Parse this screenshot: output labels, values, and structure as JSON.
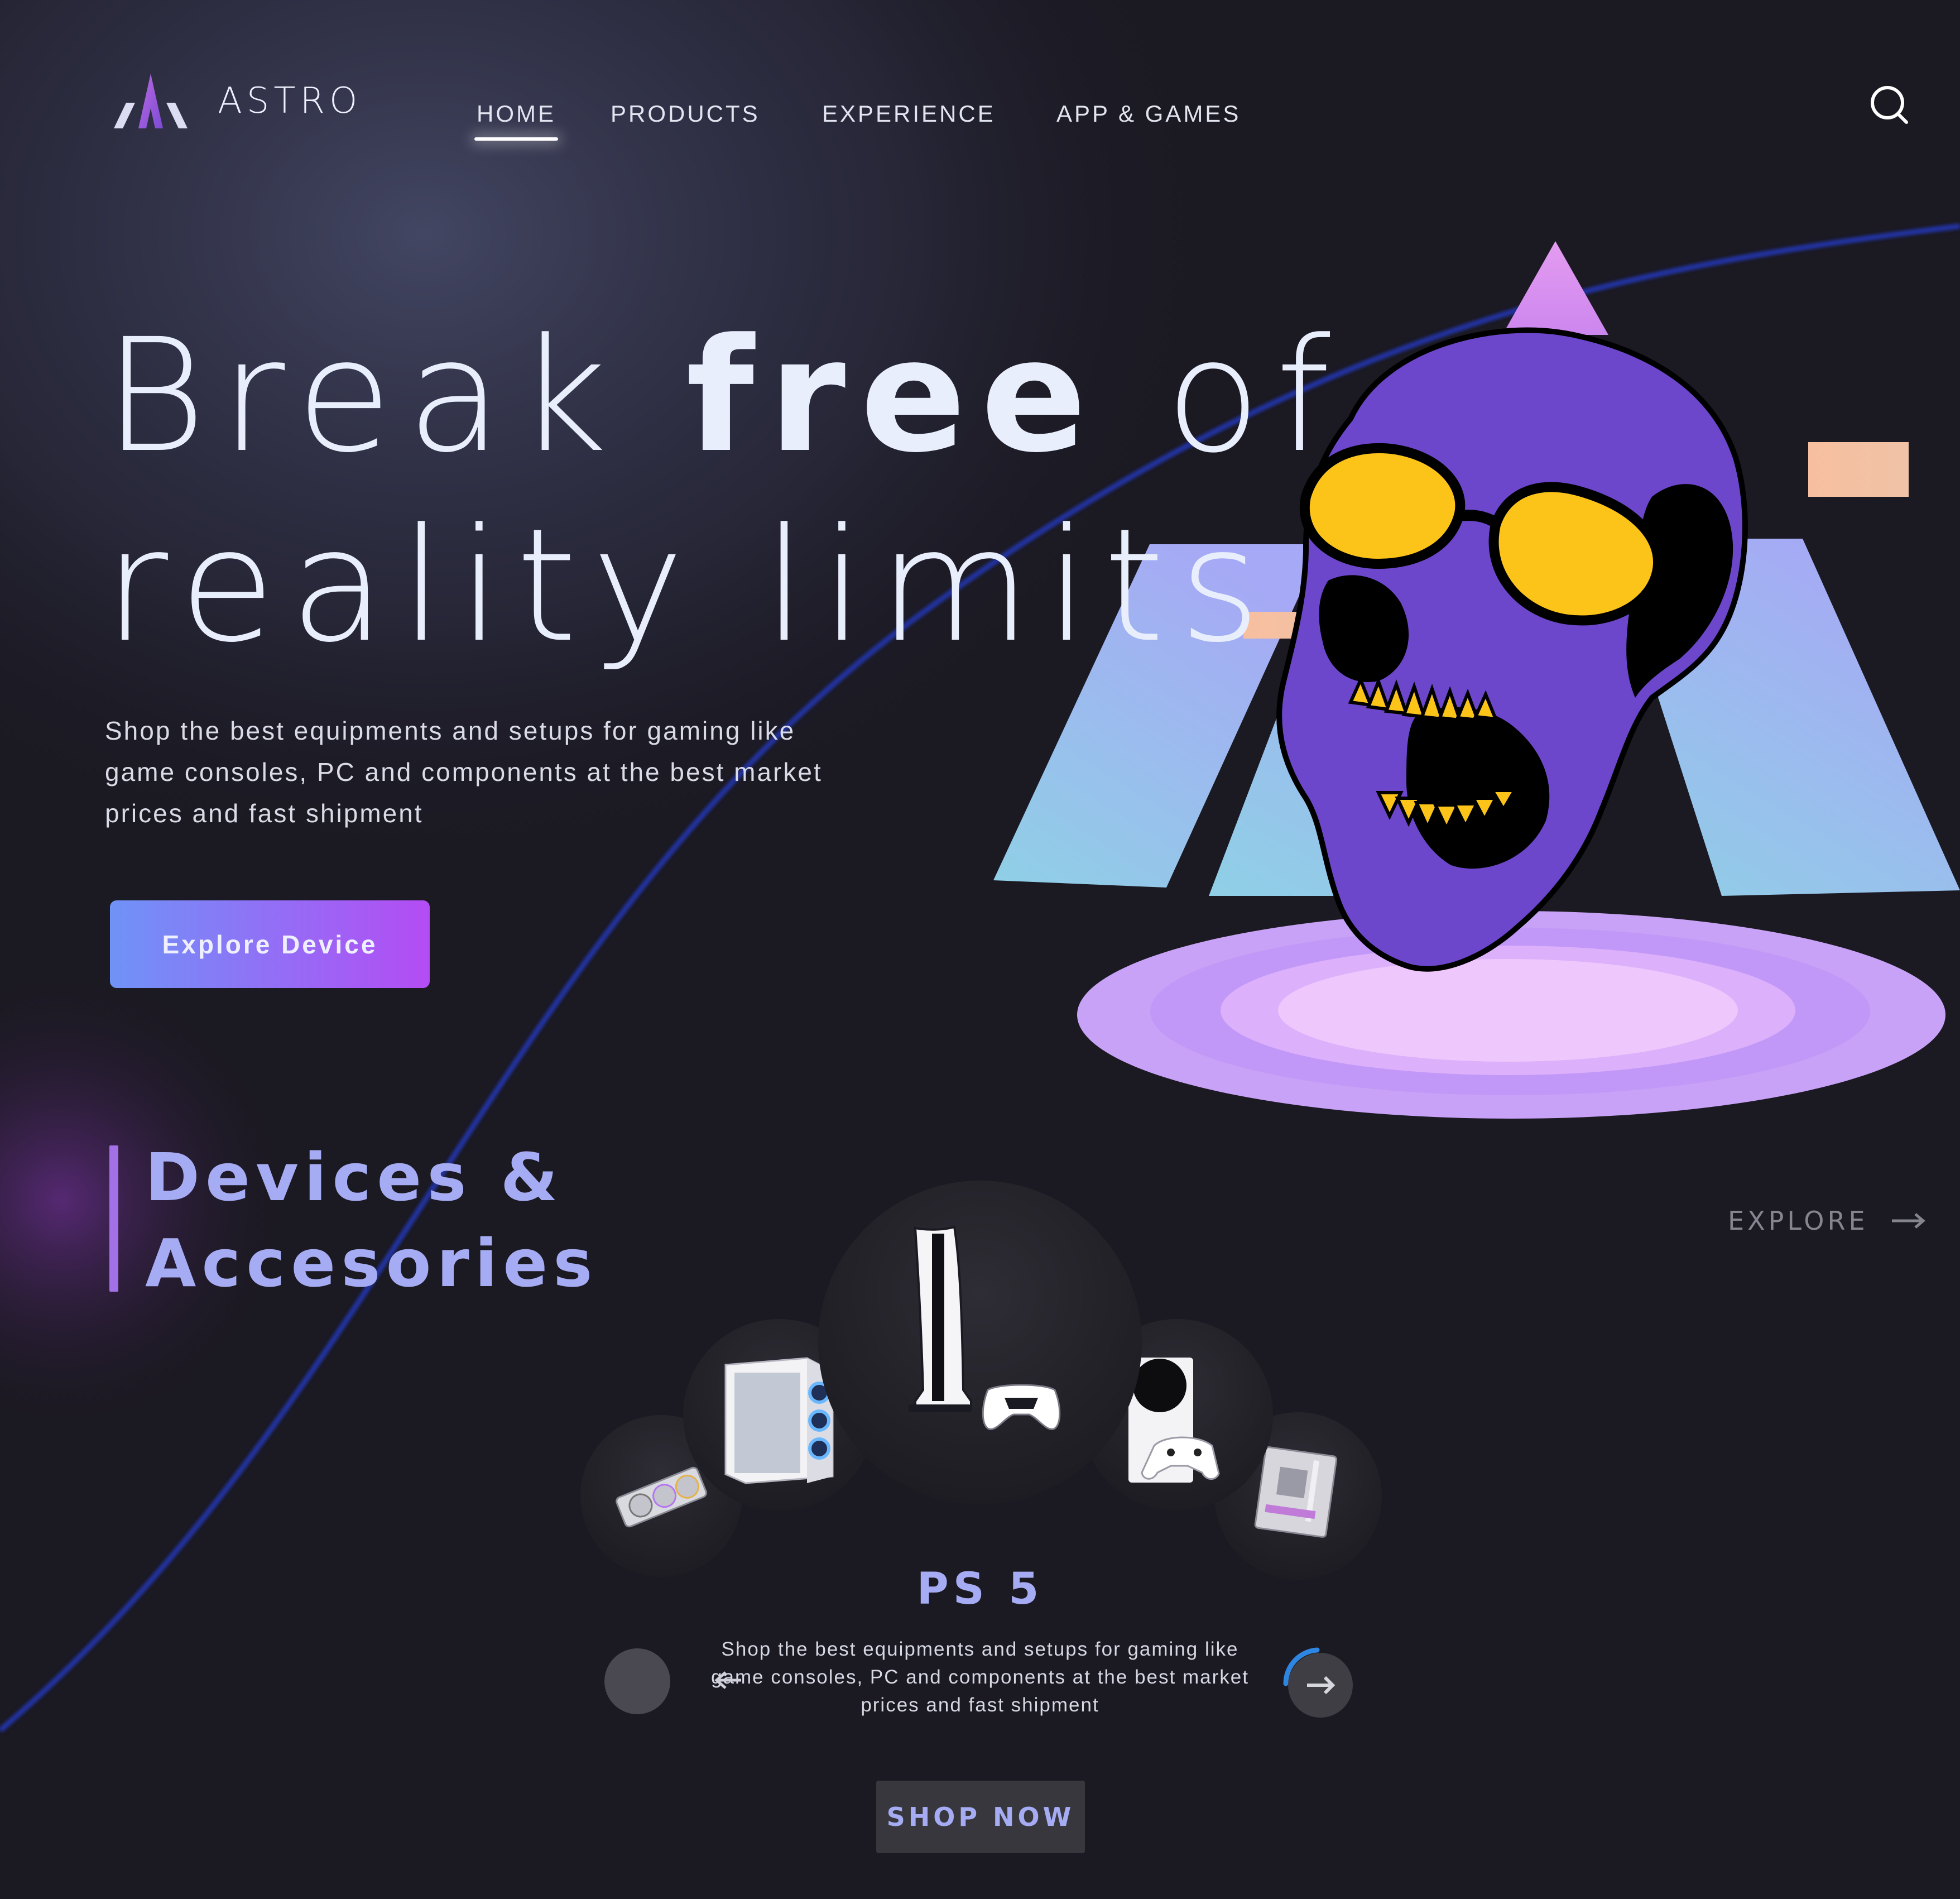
{
  "brand": {
    "name": "ASTRO"
  },
  "nav": {
    "items": [
      {
        "label": "HOME",
        "active": true
      },
      {
        "label": "PRODUCTS",
        "active": false
      },
      {
        "label": "EXPERIENCE",
        "active": false
      },
      {
        "label": "APP & GAMES",
        "active": false
      }
    ],
    "search_icon": "search-icon"
  },
  "hero": {
    "title_part1": "Break",
    "title_bold": "free",
    "title_part2": "of",
    "title_line2": "reality limits",
    "subtitle": "Shop the best equipments and setups for gaming like game consoles, PC and components at the best market prices and fast shipment",
    "cta_label": "Explore Device",
    "illustration": "skull-with-sunglasses"
  },
  "devices": {
    "title_line1": "Devices &",
    "title_line2": "Accesories",
    "explore_label": "EXPLORE",
    "carousel_items": [
      "graphics card",
      "pc case",
      "ps 5",
      "xbox series s",
      "motherboard"
    ],
    "selected_index": 2,
    "product_name": "PS 5",
    "product_description": "Shop the best equipments and setups for gaming like game consoles, PC and components at the best market prices and fast shipment",
    "shop_label": "SHOP NOW"
  },
  "colors": {
    "background": "#1b1922",
    "accent_purple": "#b44cf4",
    "accent_blue": "#6f93f7",
    "heading_lavender": "#a6acf3",
    "skull_purple": "#6e45c8",
    "sunglasses_yellow": "#fcc419"
  }
}
